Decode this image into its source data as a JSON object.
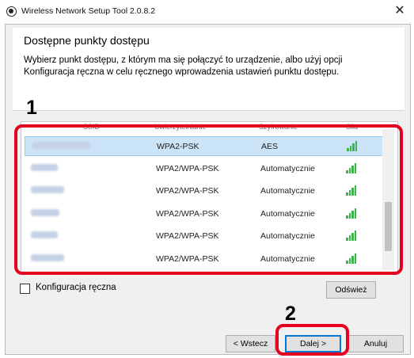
{
  "window": {
    "title": "Wireless Network Setup Tool 2.0.8.2",
    "close_glyph": "✕"
  },
  "header": {
    "heading": "Dostępne punkty dostępu",
    "description": "Wybierz punkt dostępu, z którym ma się połączyć to urządzenie, albo użyj opcji Konfiguracja ręczna w celu ręcznego wprowadzenia ustawień punktu dostępu."
  },
  "annotations": {
    "marker_1": "1",
    "marker_2": "2",
    "highlight_color": "#e6001e"
  },
  "table": {
    "columns": [
      "SSID",
      "Uwierzytelnianie",
      "Szyfrowanie",
      "Sila"
    ],
    "rows": [
      {
        "ssid": "Buffalo-G-9E08",
        "auth": "WPA2-PSK",
        "enc": "AES",
        "signal": 4,
        "selected": true
      },
      {
        "ssid": "kd-voice",
        "auth": "WPA2/WPA-PSK",
        "enc": "Automatycznie",
        "signal": 4,
        "selected": false
      },
      {
        "ssid": "kd-guest",
        "auth": "WPA2/WPA-PSK",
        "enc": "Automatycznie",
        "signal": 4,
        "selected": false
      },
      {
        "ssid": "kd-smart",
        "auth": "WPA2/WPA-PSK",
        "enc": "Automatycznie",
        "signal": 4,
        "selected": false
      },
      {
        "ssid": "kd-voice",
        "auth": "WPA2/WPA-PSK",
        "enc": "Automatycznie",
        "signal": 4,
        "selected": false
      },
      {
        "ssid": "kd-guest",
        "auth": "WPA2/WPA-PSK",
        "enc": "Automatycznie",
        "signal": 4,
        "selected": false
      }
    ],
    "signal_color": "#39b54a",
    "selected_row_color": "#cce4f7"
  },
  "options": {
    "manual_config_label": "Konfiguracja ręczna",
    "manual_config_checked": false
  },
  "buttons": {
    "refresh": "Odśwież",
    "back": "< Wstecz",
    "next": "Dalej >",
    "cancel": "Anuluj"
  }
}
